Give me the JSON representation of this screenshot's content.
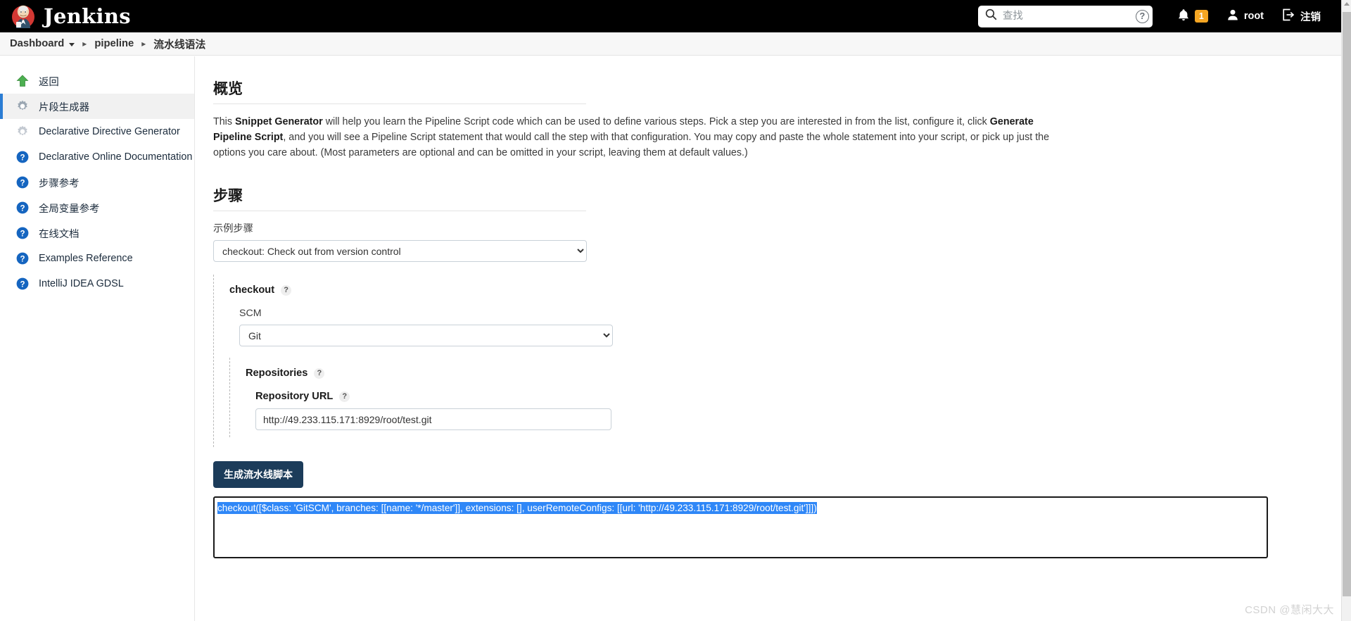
{
  "header": {
    "brand_title": "Jenkins",
    "logo_icon": "jenkins-butler-logo",
    "search": {
      "placeholder": "查找",
      "value": "",
      "icon": "search-icon",
      "help_icon": "help-circle-icon"
    },
    "notifications": {
      "icon": "bell-icon",
      "count": "1"
    },
    "user": {
      "icon": "person-icon",
      "name": "root"
    },
    "logout": {
      "icon": "logout-icon",
      "label": "注销"
    }
  },
  "breadcrumbs": {
    "items": [
      {
        "label": "Dashboard",
        "has_caret": true
      },
      {
        "label": "pipeline",
        "has_caret": false
      },
      {
        "label": "流水线语法",
        "has_caret": false
      }
    ],
    "separator": "▸"
  },
  "sidebar": {
    "items": [
      {
        "label": "返回",
        "icon": "up-arrow-icon",
        "active": false
      },
      {
        "label": "片段生成器",
        "icon": "gear-icon",
        "active": true
      },
      {
        "label": "Declarative Directive Generator",
        "icon": "gear-icon",
        "active": false
      },
      {
        "label": "Declarative Online Documentation",
        "icon": "help-icon",
        "active": false
      },
      {
        "label": "步骤参考",
        "icon": "help-icon",
        "active": false
      },
      {
        "label": "全局变量参考",
        "icon": "help-icon",
        "active": false
      },
      {
        "label": "在线文档",
        "icon": "help-icon",
        "active": false
      },
      {
        "label": "Examples Reference",
        "icon": "help-icon",
        "active": false
      },
      {
        "label": "IntelliJ IDEA GDSL",
        "icon": "help-icon",
        "active": false
      }
    ]
  },
  "main": {
    "overview": {
      "heading": "概览",
      "text_part1": "This ",
      "bold1": "Snippet Generator",
      "text_part2": " will help you learn the Pipeline Script code which can be used to define various steps. Pick a step you are interested in from the list, configure it, click ",
      "bold2": "Generate Pipeline Script",
      "text_part3": ", and you will see a Pipeline Script statement that would call the step with that configuration. You may copy and paste the whole statement into your script, or pick up just the options you care about. (Most parameters are optional and can be omitted in your script, leaving them at default values.)"
    },
    "steps": {
      "heading": "步骤",
      "sample_step_label": "示例步骤",
      "sample_step_value": "checkout: Check out from version control",
      "sample_step_options": [
        "checkout: Check out from version control"
      ],
      "checkout_block": {
        "title": "checkout",
        "help": "?",
        "scm_label": "SCM",
        "scm_value": "Git",
        "scm_options": [
          "Git"
        ],
        "repositories": {
          "title": "Repositories",
          "help": "?",
          "repo_url_label": "Repository URL",
          "repo_url_help": "?",
          "repo_url_value": "http://49.233.115.171:8929/root/test.git"
        }
      },
      "generate_button": "生成流水线脚本",
      "generated_script": "checkout([$class: 'GitSCM', branches: [[name: '*/master']], extensions: [], userRemoteConfigs: [[url: 'http://49.233.115.171:8929/root/test.git']]])"
    }
  },
  "watermark": "CSDN @慧闲大大"
}
